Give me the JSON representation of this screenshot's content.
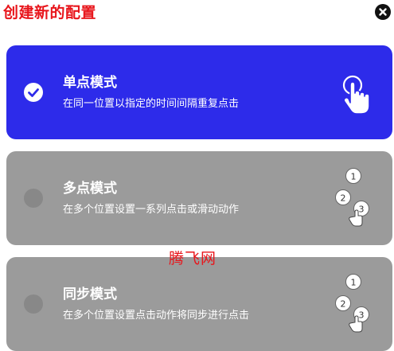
{
  "header": {
    "title": "创建新的配置",
    "close_icon": "close-icon"
  },
  "modes": [
    {
      "id": "single",
      "title": "单点模式",
      "description": "在同一位置以指定的时间间隔重复点击",
      "selected": true,
      "icon": "tap-hand-icon"
    },
    {
      "id": "multi",
      "title": "多点模式",
      "description": "在多个位置设置一系列点击或滑动动作",
      "selected": false,
      "icon": "multi-point-icon",
      "icon_labels": [
        "1",
        "2",
        "3"
      ]
    },
    {
      "id": "sync",
      "title": "同步模式",
      "description": "在多个位置设置点击动作将同步进行点击",
      "selected": false,
      "icon": "sync-point-icon",
      "icon_labels": [
        "1",
        "2",
        "3"
      ]
    }
  ],
  "watermark": "腾飞网",
  "colors": {
    "title": "#e8151b",
    "selected_card": "#2d2bea",
    "unselected_card": "#9b9b9b",
    "radio_unchecked": "#888888"
  }
}
